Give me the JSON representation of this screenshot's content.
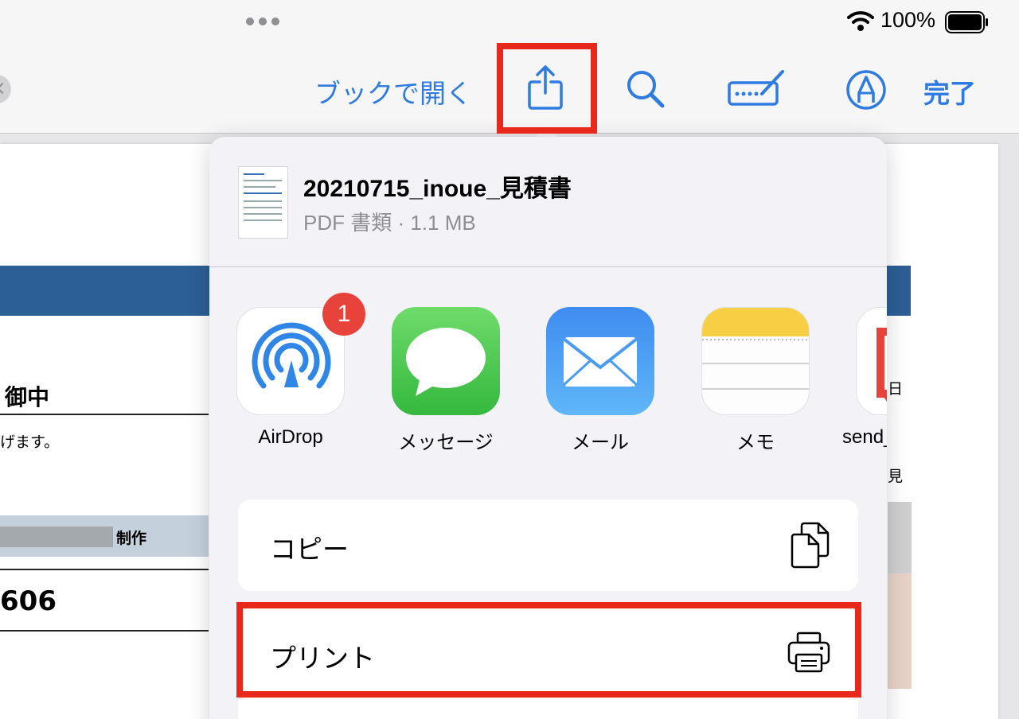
{
  "status_bar": {
    "battery_percent": "100%"
  },
  "toolbar": {
    "open_in_books_label": "ブックで開く",
    "done_label": "完了",
    "icons": [
      "share-icon",
      "search-icon",
      "keyboard-pen-icon",
      "markup-icon"
    ]
  },
  "document": {
    "text_onchu": "御中",
    "text_gemasu": "げます。",
    "text_seisaku": "制作",
    "text_number": "606",
    "side_day": "日",
    "side_mi": "見"
  },
  "share_sheet": {
    "file": {
      "name": "20210715_inoue_見積書",
      "meta": "PDF 書類 · 1.1 MB"
    },
    "apps": [
      {
        "label": "AirDrop",
        "badge": "1",
        "icon": "airdrop-icon"
      },
      {
        "label": "メッセージ",
        "icon": "messages-icon"
      },
      {
        "label": "メール",
        "icon": "mail-icon"
      },
      {
        "label": "メモ",
        "icon": "notes-icon"
      },
      {
        "label": "send_",
        "icon": "send-app-icon"
      }
    ],
    "actions": [
      {
        "label": "コピー",
        "icon": "copy-icon"
      },
      {
        "label": "プリント",
        "icon": "printer-icon"
      }
    ]
  },
  "colors": {
    "accent": "#2f7be0",
    "highlight": "#e8281a",
    "doc_band": "#2c5f96"
  }
}
